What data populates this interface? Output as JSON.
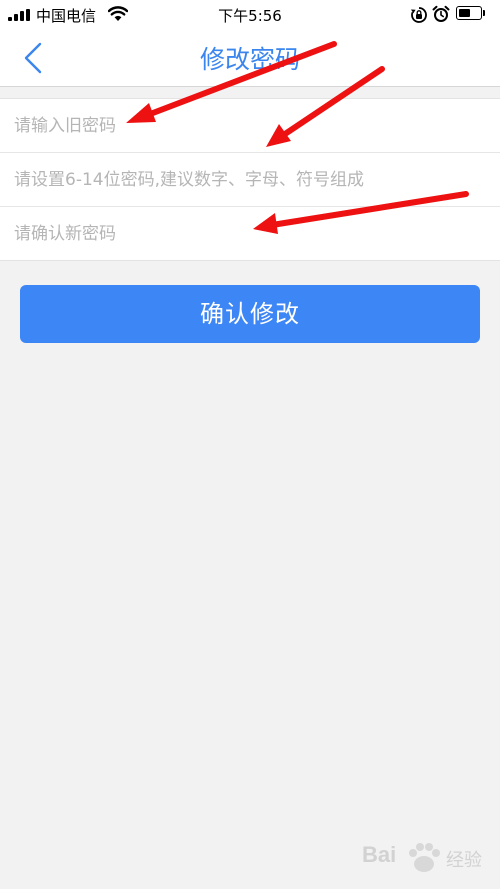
{
  "status_bar": {
    "carrier": "中国电信",
    "time": "下午5:56",
    "battery_level": 0.55
  },
  "nav": {
    "title": "修改密码"
  },
  "form": {
    "old_password_placeholder": "请输入旧密码",
    "new_password_placeholder": "请设置6-14位密码,建议数字、字母、符号组成",
    "confirm_password_placeholder": "请确认新密码"
  },
  "confirm_button": {
    "label": "确认修改"
  },
  "watermark": {
    "logo_text": "Bai",
    "logo_suffix": "经验"
  },
  "colors": {
    "accent": "#3a86ee",
    "button": "#3d86f5",
    "annotation_arrow": "#ee1111",
    "background": "#f2f2f2"
  }
}
